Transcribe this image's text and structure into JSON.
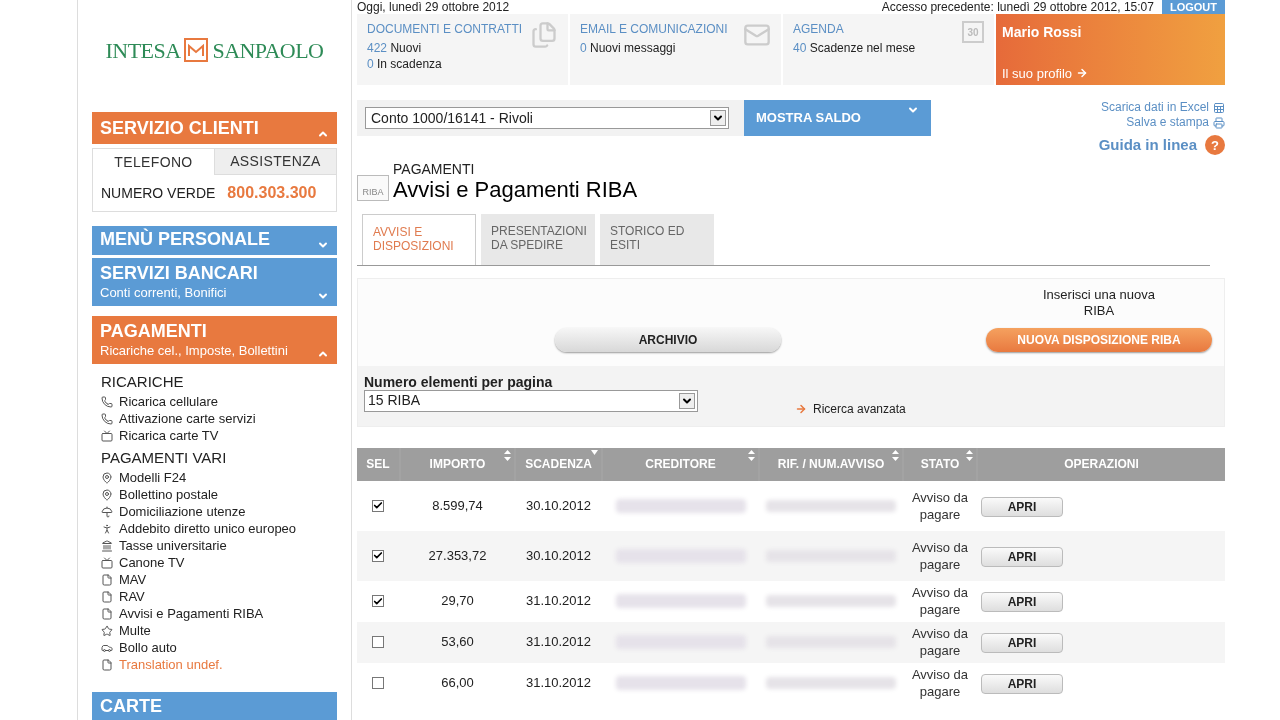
{
  "top_bar": {
    "date": "Oggi, lunedì 29 ottobre 2012",
    "last_access": "Accesso precedente: lunedì 29 ottobre 2012, 15:07",
    "logout": "LOGOUT"
  },
  "logo": {
    "left": "INTESA",
    "right": "SANPAOLO"
  },
  "customer_service": {
    "title": "SERVIZIO CLIENTI",
    "tabs": [
      {
        "label": "TELEFONO",
        "selected": true
      },
      {
        "label": "ASSISTENZA",
        "selected": false
      }
    ],
    "label": "NUMERO VERDE",
    "number": "800.303.300"
  },
  "sections": [
    {
      "title": "MENÙ PERSONALE",
      "color": "#5b9bd5",
      "expanded": false
    },
    {
      "title": "SERVIZI BANCARI",
      "subtitle": "Conti correnti, Bonifici",
      "color": "#5b9bd5",
      "expanded": false
    },
    {
      "title": "PAGAMENTI",
      "subtitle": "Ricariche cel., Imposte, Bollettini",
      "color": "#e8793f",
      "expanded": true
    }
  ],
  "menu_groups": [
    {
      "title": "RICARICHE",
      "items": [
        {
          "label": "Ricarica cellulare",
          "kind": "recharge",
          "color": "#222222"
        },
        {
          "label": "Attivazione carte servizi",
          "kind": "recharge",
          "color": "#222222"
        },
        {
          "label": "Ricarica carte TV",
          "kind": "tv",
          "color": "#222222"
        }
      ]
    },
    {
      "title": "PAGAMENTI VARI",
      "items": [
        {
          "label": "Modelli F24",
          "kind": "pin",
          "color": "#222222"
        },
        {
          "label": "Bollettino postale",
          "kind": "pin",
          "color": "#222222"
        },
        {
          "label": "Domiciliazione utenze",
          "kind": "umbrella",
          "color": "#222222"
        },
        {
          "label": "Addebito diretto unico europeo",
          "kind": "person",
          "color": "#222222"
        },
        {
          "label": "Tasse universitarie",
          "kind": "building",
          "color": "#222222"
        },
        {
          "label": "Canone TV",
          "kind": "tv",
          "color": "#222222"
        },
        {
          "label": "MAV",
          "kind": "document",
          "color": "#222222"
        },
        {
          "label": "RAV",
          "kind": "document",
          "color": "#222222"
        },
        {
          "label": "Avvisi e Pagamenti RIBA",
          "kind": "document",
          "color": "#222222"
        },
        {
          "label": "Multe",
          "kind": "star",
          "color": "#222222"
        },
        {
          "label": "Bollo auto",
          "kind": "car",
          "color": "#222222"
        },
        {
          "label": "Translation undef.",
          "kind": "document",
          "color": "#e8793f"
        }
      ]
    }
  ],
  "bottom_section": {
    "title": "CARTE"
  },
  "tiles": [
    {
      "title": "DOCUMENTI E CONTRATTI",
      "kind": "documents",
      "lines": [
        {
          "count": "422",
          "text": "Nuovi"
        },
        {
          "count": "0",
          "text": "In scadenza"
        }
      ]
    },
    {
      "title": "EMAIL E COMUNICAZIONI",
      "kind": "mail",
      "lines": [
        {
          "count": "0",
          "text": "Nuovi messaggi"
        }
      ]
    },
    {
      "title": "AGENDA",
      "kind": "calendar",
      "icon_text": "30",
      "lines": [
        {
          "count": "40",
          "text": "Scadenze nel mese"
        }
      ]
    }
  ],
  "profile": {
    "name": "Mario Rossi",
    "link": "Il suo profilo"
  },
  "account": {
    "value": "Conto 1000/16141 - Rivoli",
    "button": "MOSTRA SALDO"
  },
  "links": [
    {
      "label": "Scarica dati in Excel",
      "kind": "excel"
    },
    {
      "label": "Salva e stampa",
      "kind": "print"
    }
  ],
  "help": {
    "label": "Guida in linea",
    "icon_text": "?"
  },
  "page": {
    "icon_text": "RIBA",
    "section": "PAGAMENTI",
    "title": "Avvisi e Pagamenti RIBA"
  },
  "tabs": [
    {
      "label": "AVVISI E DISPOSIZIONI",
      "selected": true
    },
    {
      "label": "PRESENTAZIONI DA SPEDIRE",
      "selected": false
    },
    {
      "label": "STORICO ED ESITI",
      "selected": false
    }
  ],
  "actions": {
    "archive": "ARCHIVIO",
    "new_hint": "Inserisci una nuova RIBA",
    "new_button": "NUOVA DISPOSIZIONE RIBA"
  },
  "filters": {
    "page_size_label": "Numero elementi per pagina",
    "page_size": "15 RIBA",
    "advanced_search": "Ricerca avanzata"
  },
  "table": {
    "columns": [
      {
        "label": "SEL",
        "sortable": false
      },
      {
        "label": "IMPORTO",
        "sortable": true,
        "sorted": false
      },
      {
        "label": "SCADENZA",
        "sortable": true,
        "sorted": true
      },
      {
        "label": "CREDITORE",
        "sortable": true,
        "sorted": false
      },
      {
        "label": "RIF. / NUM.AVVISO",
        "sortable": true,
        "sorted": false
      },
      {
        "label": "STATO",
        "sortable": true,
        "sorted": false
      },
      {
        "label": "OPERAZIONI",
        "sortable": false
      }
    ],
    "rows": [
      {
        "checked": true,
        "amount": "8.599,74",
        "due": "30.10.2012",
        "status": "Avviso da pagare",
        "action": "APRI"
      },
      {
        "checked": true,
        "amount": "27.353,72",
        "due": "30.10.2012",
        "status": "Avviso da pagare",
        "action": "APRI"
      },
      {
        "checked": true,
        "amount": "29,70",
        "due": "31.10.2012",
        "status": "Avviso da pagare",
        "action": "APRI"
      },
      {
        "checked": false,
        "amount": "53,60",
        "due": "31.10.2012",
        "status": "Avviso da pagare",
        "action": "APRI"
      },
      {
        "checked": false,
        "amount": "66,00",
        "due": "31.10.2012",
        "status": "Avviso da pagare",
        "action": "APRI"
      }
    ]
  }
}
